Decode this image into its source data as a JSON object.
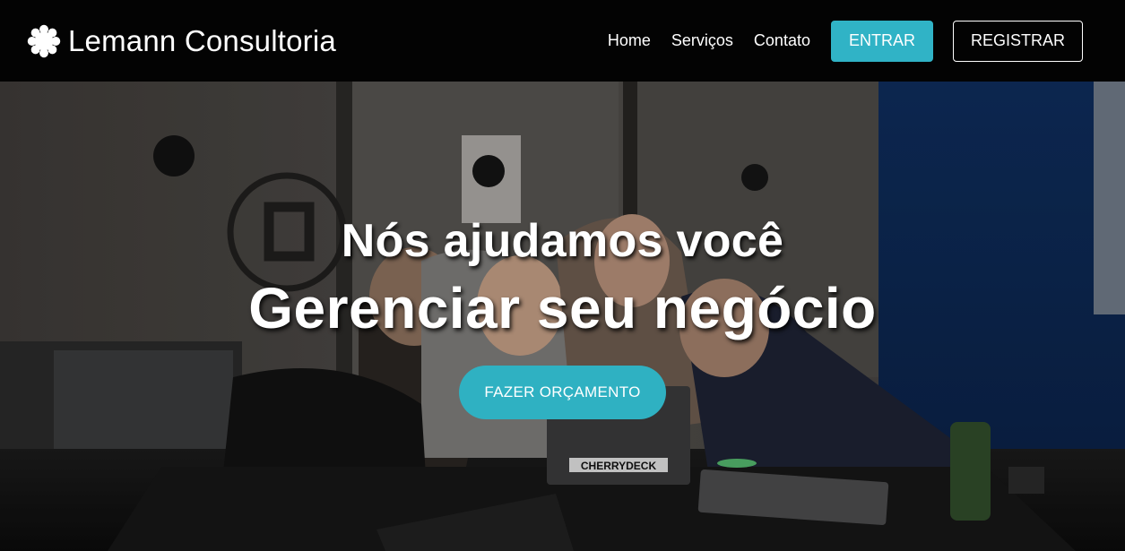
{
  "navbar": {
    "brand_name": "Lemann Consultoria",
    "brand_icon": "flower-logo-icon",
    "links": [
      "Home",
      "Serviços",
      "Contato"
    ],
    "login_label": "ENTRAR",
    "register_label": "REGISTRAR"
  },
  "hero": {
    "title": "Nós ajudamos você",
    "subtitle": "Gerenciar seu negócio",
    "cta_label": "FAZER ORÇAMENTO",
    "laptop_sticker": "CHERRYDECK"
  },
  "colors": {
    "navbar_bg": "#030303",
    "accent": "#30b3c6",
    "text": "#ffffff"
  }
}
